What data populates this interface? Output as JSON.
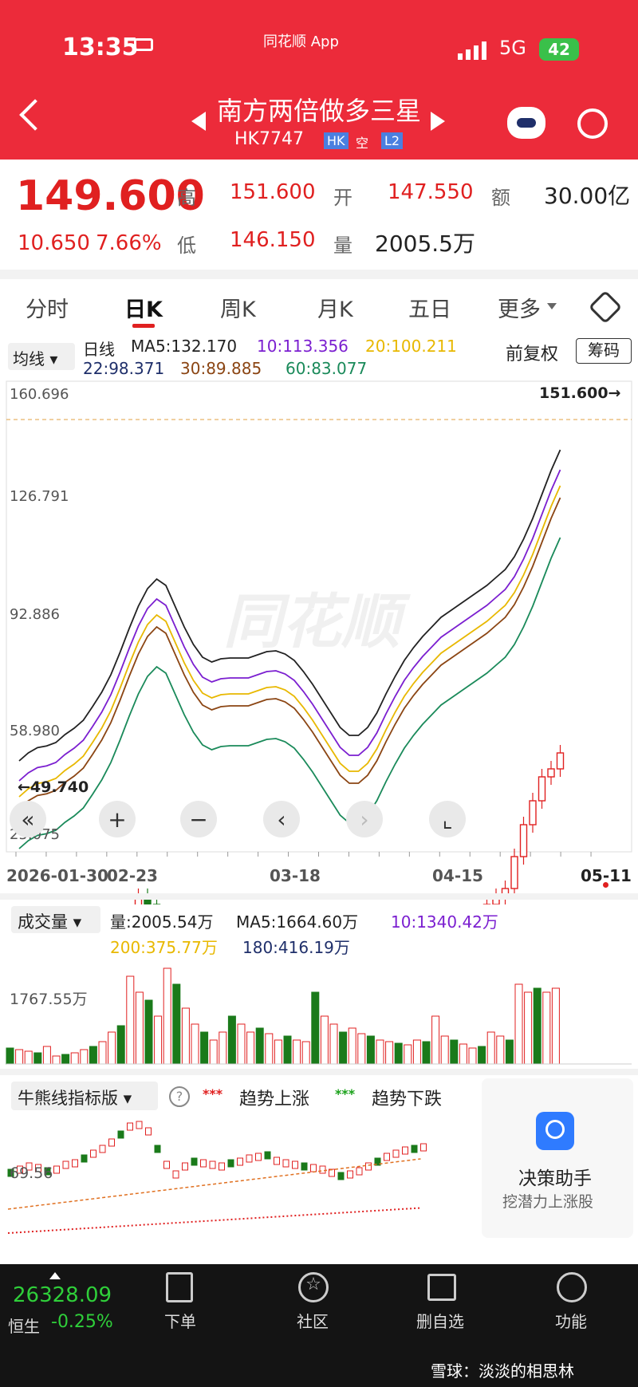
{
  "status_bar": {
    "time": "13:35",
    "bed_icon": "bed-icon",
    "source": "同花顺 App",
    "network": "5G",
    "battery": "42"
  },
  "title_bar": {
    "stock_name": "南方两倍做多三星",
    "code": "HK7747",
    "badges": [
      "HK",
      "空",
      "L2"
    ]
  },
  "quote": {
    "price": "149.600",
    "change": "10.650",
    "change_pct": "7.66%",
    "high_label": "高",
    "high": "151.600",
    "open_label": "开",
    "open": "147.550",
    "amount_label": "额",
    "amount": "30.00亿",
    "low_label": "低",
    "low": "146.150",
    "volume_label": "量",
    "volume": "2005.5万"
  },
  "tabs": [
    "分时",
    "日K",
    "周K",
    "月K",
    "五日",
    "更多"
  ],
  "active_tab": "日K",
  "ma_panel": {
    "selector": "均线",
    "period": "日线",
    "ma5": "MA5:132.170",
    "ma10": "10:113.356",
    "ma20": "20:100.211",
    "ma22": "22:98.371",
    "ma30": "30:89.885",
    "ma60": "60:83.077",
    "adjust": "前复权",
    "chips": "筹码"
  },
  "kchart": {
    "y_labels": [
      "160.696",
      "126.791",
      "92.886",
      "58.980",
      "25.075"
    ],
    "max_marker": "151.600→",
    "min_marker": "←49.740",
    "x_labels": [
      "2026-01-30",
      "02-23",
      "03-18",
      "04-15",
      "05-11"
    ],
    "watermark": "同花顺"
  },
  "volume_panel": {
    "selector": "成交量",
    "vol": "量:2005.54万",
    "ma5": "MA5:1664.60万",
    "ma10": "10:1340.42万",
    "ma200": "200:375.77万",
    "ma180": "180:416.19万",
    "y_label": "1767.55万"
  },
  "bull_bear": {
    "selector": "牛熊线指标版",
    "up": "趋势上涨",
    "down": "趋势下跌",
    "y_label": "69.56"
  },
  "assistant": {
    "title": "决策助手",
    "subtitle": "挖潜力上涨股"
  },
  "bottom_bar": {
    "index_value": "26328.09",
    "index_name": "恒生",
    "index_change": "-0.25%",
    "buttons": [
      "下单",
      "社区",
      "删自选",
      "功能"
    ]
  },
  "watermark_footer": "雪球：淡淡的相思林",
  "colors": {
    "header": "#ec2b3a",
    "up": "#e02020",
    "down": "#1a7a1a",
    "ma5": "#222222",
    "ma10": "#7b1fd0",
    "ma20": "#e8b800",
    "ma30": "#8b4513",
    "ma60": "#1a8a5a"
  }
}
